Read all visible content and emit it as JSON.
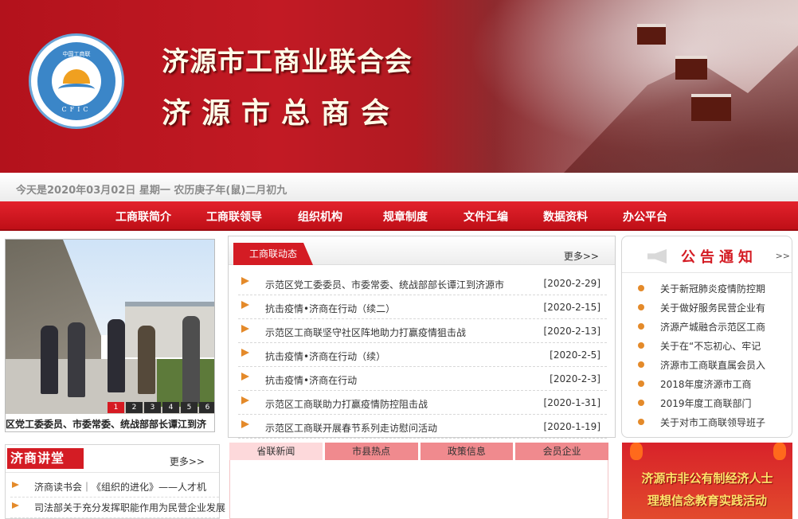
{
  "banner": {
    "title_line1": "济源市工商业联合会",
    "title_line2": "济源市总商会",
    "logo_top_text": "中国工商联",
    "logo_bottom_text": "CFIC"
  },
  "datebar": {
    "text": "今天是2020年03月02日  星期一  农历庚子年(鼠)二月初九"
  },
  "nav": {
    "items": [
      {
        "label": "工商联简介"
      },
      {
        "label": "工商联领导"
      },
      {
        "label": "组织机构"
      },
      {
        "label": "规章制度"
      },
      {
        "label": "文件汇编"
      },
      {
        "label": "数据资料"
      },
      {
        "label": "办公平台"
      }
    ]
  },
  "slider": {
    "caption": "区党工委委员、市委常委、统战部部长谭江到济",
    "pages": [
      "1",
      "2",
      "3",
      "4",
      "5",
      "6"
    ],
    "current_page": "1"
  },
  "news": {
    "tab_label": "工商联动态",
    "more_label": "更多>>",
    "items": [
      {
        "title": "示范区党工委委员、市委常委、统战部部长谭江到济源市",
        "date": "[2020-2-29]"
      },
      {
        "title": "抗击疫情•济商在行动（续二）",
        "date": "[2020-2-15]"
      },
      {
        "title": "示范区工商联坚守社区阵地助力打赢疫情狙击战",
        "date": "[2020-2-13]"
      },
      {
        "title": "抗击疫情•济商在行动（续）",
        "date": "[2020-2-5]"
      },
      {
        "title": "抗击疫情•济商在行动",
        "date": "[2020-2-3]"
      },
      {
        "title": "示范区工商联助力打赢疫情防控阻击战",
        "date": "[2020-1-31]"
      },
      {
        "title": "示范区工商联开展春节系列走访慰问活动",
        "date": "[2020-1-19]"
      }
    ]
  },
  "notice": {
    "title": "公告通知",
    "more_label": ">>",
    "items": [
      {
        "title": "关于新冠肺炎疫情防控期"
      },
      {
        "title": "关于做好服务民营企业有"
      },
      {
        "title": "济源产城融合示范区工商"
      },
      {
        "title": "关于在“不忘初心、牢记"
      },
      {
        "title": "济源市工商联直属会员入"
      },
      {
        "title": "2018年度济源市工商"
      },
      {
        "title": "2019年度工商联部门"
      },
      {
        "title": "关于对市工商联领导班子"
      }
    ]
  },
  "lecture": {
    "badge": "济商讲堂",
    "more_label": "更多>>",
    "items": [
      {
        "title": "济商读书会｜《组织的进化》——人才机"
      },
      {
        "title": "司法部关于充分发挥职能作用为民营企业发展"
      }
    ]
  },
  "tabs": {
    "items": [
      {
        "label": "省联新闻"
      },
      {
        "label": "市县热点"
      },
      {
        "label": "政策信息"
      },
      {
        "label": "会员企业"
      }
    ],
    "active": "省联新闻"
  },
  "promo": {
    "line1": "济源市非公有制经济人士",
    "line2": "理想信念教育实践活动"
  },
  "colors": {
    "brand_red": "#d41c24",
    "nav_red": "#e3222c",
    "accent_orange": "#e48a2a"
  }
}
